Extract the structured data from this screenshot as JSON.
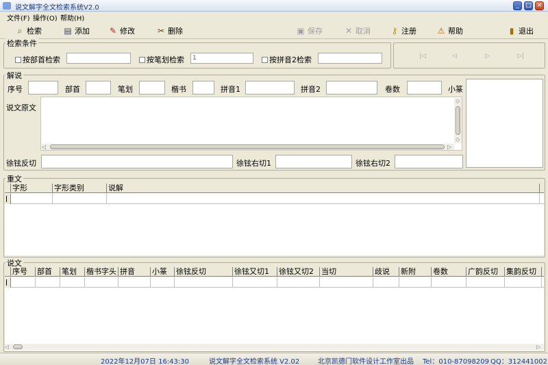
{
  "window": {
    "title": "说文解字全文检索系统V2.0",
    "btn_min": "_",
    "btn_max": "□",
    "btn_close": "×"
  },
  "menu": [
    {
      "label": "文件(F)"
    },
    {
      "label": "操作(O)"
    },
    {
      "label": "帮助(H)"
    }
  ],
  "toolbar": {
    "search": "检索",
    "add": "添加",
    "edit": "修改",
    "delete": "删除",
    "save": "保存",
    "cancel": "取消",
    "register": "注册",
    "help": "帮助",
    "exit": "退出"
  },
  "search_conditions": {
    "title": "检索条件",
    "by_radical": "按部首检索",
    "by_strokes": "按笔划检索",
    "strokes_value": "1",
    "by_pinyin2": "按拼音2检索",
    "nav_first": "|◁",
    "nav_prev": "◁",
    "nav_next": "▷",
    "nav_last": "▷|"
  },
  "explanation": {
    "title": "解说",
    "seq": "序号",
    "radical": "部首",
    "strokes": "笔划",
    "kaishu": "楷书",
    "pinyin1": "拼音1",
    "pinyin2": "拼音2",
    "volume": "卷数",
    "xiaozhuan": "小篆",
    "original_text": "说文原文",
    "xuxuan_fanqie": "徐铉反切",
    "xuxuan_youqie1": "徐铉右切1",
    "xuxuan_youqie2": "徐铉右切2"
  },
  "chongwen": {
    "title": "重文",
    "columns": [
      "字形",
      "字形类别",
      "说解"
    ]
  },
  "shuowen": {
    "title": "说文",
    "columns": [
      "序号",
      "部首",
      "笔划",
      "楷书字头",
      "拼音",
      "小篆",
      "徐铉反切",
      "徐铉又切1",
      "徐铉又切2",
      "当切",
      "歧说",
      "新附",
      "卷数",
      "广韵反切",
      "集韵反切"
    ]
  },
  "status": {
    "datetime": "2022年12月07日 16:43:30",
    "app": "说文解字全文检索系统 V2.02",
    "company": "北京凯德门软件设计工作室出品",
    "tel": "Tel：010-87098209",
    "qq": "QQ：312441002"
  }
}
